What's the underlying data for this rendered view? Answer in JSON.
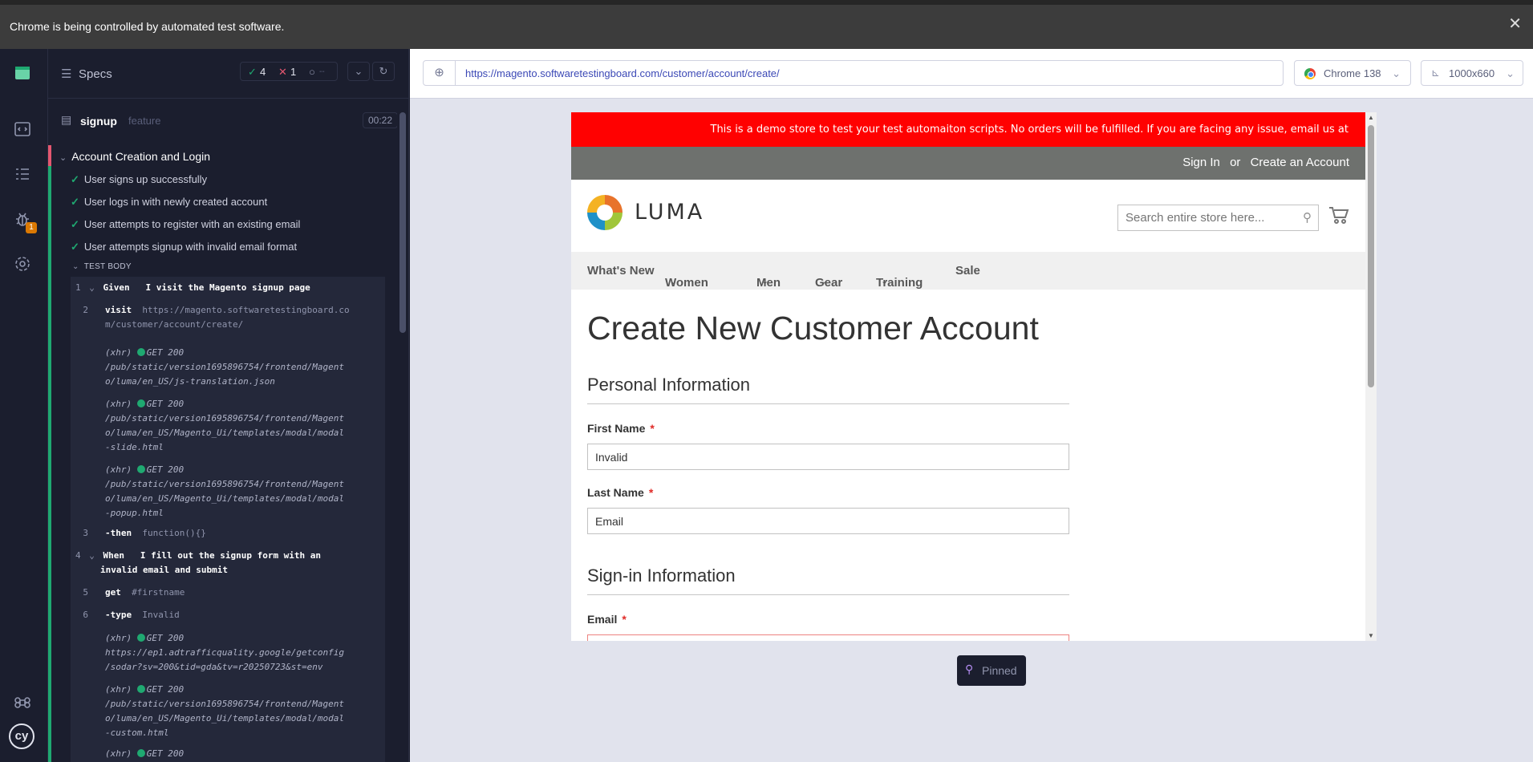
{
  "banner": {
    "message": "Chrome is being controlled by automated test software.",
    "close": "✕"
  },
  "rail": {
    "badge": "1"
  },
  "reporter": {
    "specs_label": "Specs",
    "stats": {
      "passed": "4",
      "failed": "1",
      "pending": "--"
    },
    "spec": {
      "name": "signup",
      "ext": "feature",
      "duration": "00:22"
    },
    "suite_title": "Account Creation and Login",
    "tests": [
      "User signs up successfully",
      "User logs in with newly created account",
      "User attempts to register with an existing email",
      "User attempts signup with invalid email format"
    ],
    "test_body_label": "TEST BODY",
    "steps": {
      "s1": {
        "num": "1",
        "keyword": "Given",
        "text": "I visit the Magento signup page"
      },
      "s2": {
        "num": "2",
        "cmd": "visit",
        "arg1": "https://magento.softwaretestingboard.co",
        "arg2": "m/customer/account/create/"
      },
      "x1": {
        "tag": "(xhr)",
        "status": "GET 200",
        "l1": "/pub/static/version1695896754/frontend/Magent",
        "l2": "o/luma/en_US/js-translation.json"
      },
      "x2": {
        "tag": "(xhr)",
        "status": "GET 200",
        "l1": "/pub/static/version1695896754/frontend/Magent",
        "l2": "o/luma/en_US/Magento_Ui/templates/modal/modal",
        "l3": "-slide.html"
      },
      "x3": {
        "tag": "(xhr)",
        "status": "GET 200",
        "l1": "/pub/static/version1695896754/frontend/Magent",
        "l2": "o/luma/en_US/Magento_Ui/templates/modal/modal",
        "l3": "-popup.html"
      },
      "s3": {
        "num": "3",
        "cmd": "-then",
        "arg": "function(){}"
      },
      "s4": {
        "num": "4",
        "keyword": "When",
        "text1": "I fill out the signup form with an",
        "text2": "invalid email and submit"
      },
      "s5": {
        "num": "5",
        "cmd": "get",
        "arg": "#firstname"
      },
      "s6": {
        "num": "6",
        "cmd": "-type",
        "arg": "Invalid"
      },
      "x4": {
        "tag": "(xhr)",
        "status": "GET 200",
        "l1": "https://ep1.adtrafficquality.google/getconfig",
        "l2": "/sodar?sv=200&tid=gda&tv=r20250723&st=env"
      },
      "x5": {
        "tag": "(xhr)",
        "status": "GET 200",
        "l1": "/pub/static/version1695896754/frontend/Magent",
        "l2": "o/luma/en_US/Magento_Ui/templates/modal/modal",
        "l3": "-custom.html"
      },
      "x6": {
        "tag": "(xhr)",
        "status": "GET 200"
      }
    }
  },
  "aut": {
    "url": "https://magento.softwaretestingboard.com/customer/account/create/",
    "browser": "Chrome 138",
    "viewport": "1000x660",
    "pinned": "Pinned"
  },
  "site": {
    "demo_notice": "This is a demo store to test your test automaiton scripts. No orders will be fulfilled. If you are facing any issue, email us at hello@softwaretestingboard.com.",
    "sign_in": "Sign In",
    "or": "or",
    "create_account": "Create an Account",
    "logo_text": "LUMA",
    "search_placeholder": "Search entire store here...",
    "nav": [
      "What's New",
      "Women",
      "Men",
      "Gear",
      "Training",
      "Sale"
    ],
    "page_title": "Create New Customer Account",
    "personal_info": "Personal Information",
    "first_name_label": "First Name",
    "first_name_value": "Invalid",
    "last_name_label": "Last Name",
    "last_name_value": "Email",
    "signin_info": "Sign-in Information",
    "email_label": "Email",
    "required_mark": "*"
  },
  "colors": {
    "pass": "#1fa971",
    "fail": "#e45770",
    "demo_red": "#ff0101",
    "accent_link": "#3c49b6"
  }
}
